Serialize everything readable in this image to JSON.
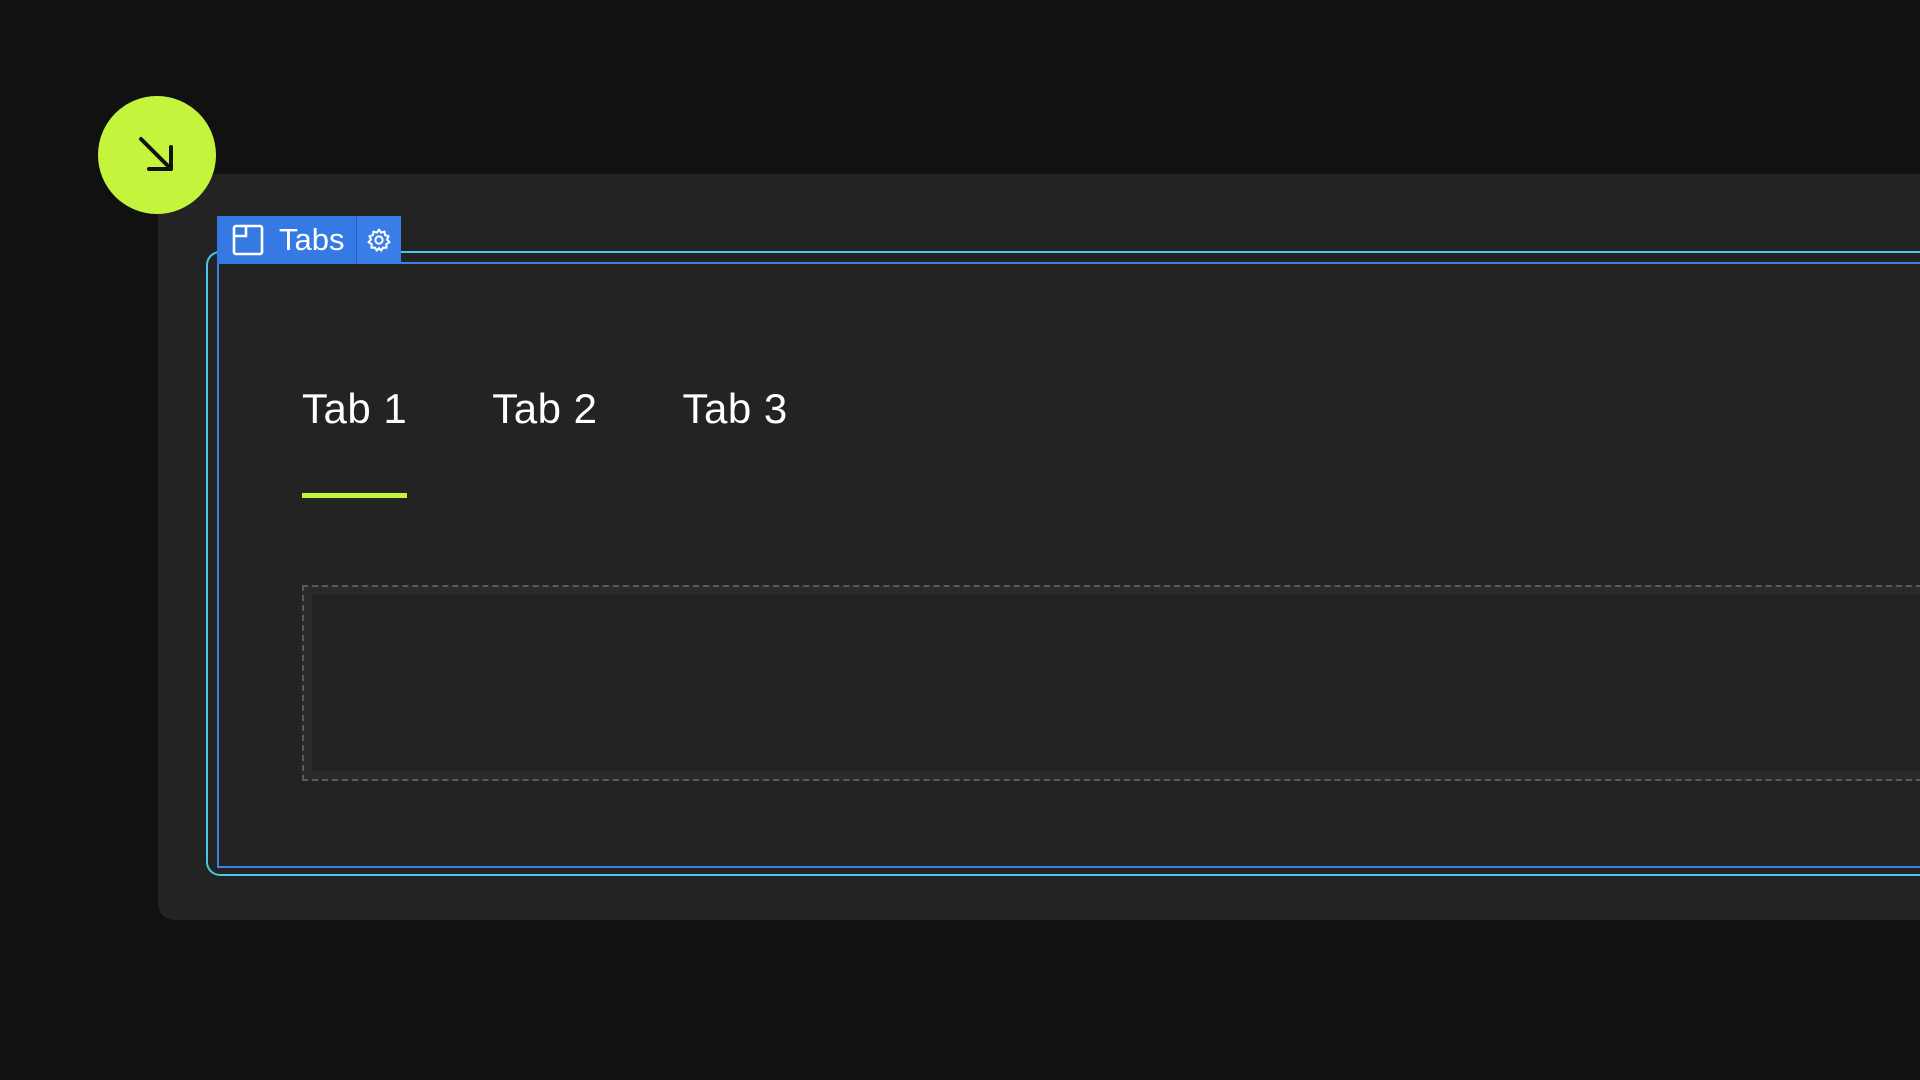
{
  "badge": {
    "icon": "arrow-down-right-icon",
    "color": "#C4F53C"
  },
  "toolbar": {
    "widget_icon": "tabs-widget-icon",
    "label": "Tabs",
    "settings_icon": "gear-icon",
    "color": "#3579E5"
  },
  "tabs": {
    "items": [
      {
        "label": "Tab 1",
        "active": true
      },
      {
        "label": "Tab 2",
        "active": false
      },
      {
        "label": "Tab 3",
        "active": false
      }
    ],
    "active_indicator_color": "#C4F53C"
  },
  "colors": {
    "background": "#111111",
    "panel": "#232323",
    "selection_outer": "#4CC6E8",
    "selection_inner": "#3B82E6"
  }
}
